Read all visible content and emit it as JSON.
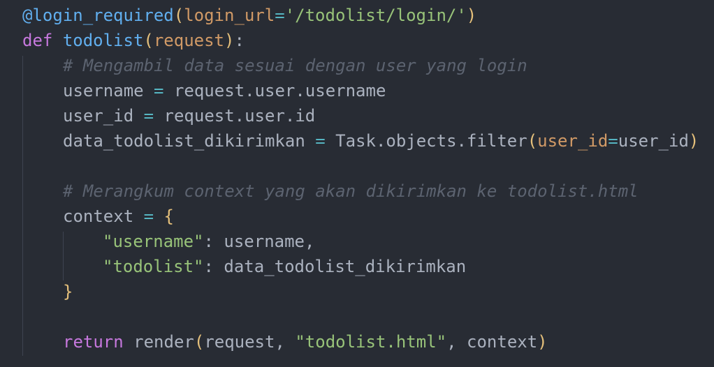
{
  "code": {
    "line1": {
      "decorator": "@login_required",
      "open": "(",
      "param": "login_url",
      "eq": "=",
      "value": "'/todolist/login/'",
      "close": ")"
    },
    "line2": {
      "keyword": "def",
      "func": "todolist",
      "open": "(",
      "param": "request",
      "close": ")",
      "colon": ":"
    },
    "line3": {
      "comment": "# Mengambil data sesuai dengan user yang login"
    },
    "line4": {
      "lhs": "username",
      "op": "=",
      "rhs": "request.user.username"
    },
    "line5": {
      "lhs": "user_id",
      "op": "=",
      "rhs": "request.user.id"
    },
    "line6": {
      "lhs": "data_todolist_dikirimkan",
      "op": "=",
      "call": "Task.objects.filter",
      "open": "(",
      "kw": "user_id",
      "eq": "=",
      "arg": "user_id",
      "close": ")"
    },
    "line8": {
      "comment": "# Merangkum context yang akan dikirimkan ke todolist.html"
    },
    "line9": {
      "lhs": "context",
      "op": "=",
      "brace": "{"
    },
    "line10": {
      "key": "\"username\"",
      "colon": ":",
      "value": "username,"
    },
    "line11": {
      "key": "\"todolist\"",
      "colon": ":",
      "value": "data_todolist_dikirimkan"
    },
    "line12": {
      "brace": "}"
    },
    "line14": {
      "keyword": "return",
      "call": "render",
      "open": "(",
      "arg1": "request,",
      "arg2": "\"todolist.html\"",
      "sep": ",",
      "arg3": "context",
      "close": ")"
    }
  },
  "colors": {
    "background": "#282c34",
    "keyword": "#c678dd",
    "function": "#61afef",
    "string": "#98c379",
    "comment": "#5c6370",
    "operator": "#56b6c2",
    "bracket": "#e5c07b",
    "parameter": "#d19a66",
    "text": "#abb2bf"
  }
}
